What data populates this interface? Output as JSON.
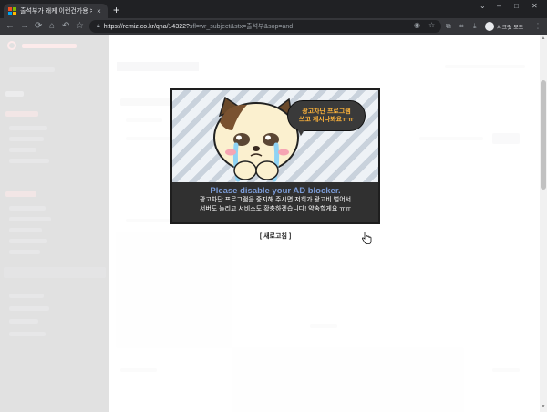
{
  "browser": {
    "tab_title": "출석부가 왜케 이런건가용 > 질문",
    "tab_close": "×",
    "new_tab": "+",
    "window_minimize": "–",
    "window_maximize": "□",
    "window_close": "✕",
    "tab_dropdown": "⌄",
    "url_host": "https://remiz.co.kr/qna/14322?",
    "url_rest": "sfl=wr_subject&stx=출석부&sop=and",
    "profile_label": "시크릿 모드",
    "nav": {
      "back": "←",
      "forward": "→",
      "reload": "⟳",
      "home": "⌂",
      "bookmark": "☆"
    }
  },
  "modal": {
    "speech_line1": "광고차단 프로그램",
    "speech_line2": "쓰고 계시나봐요ㅠㅠ",
    "headline": "Please disable your AD blocker.",
    "body_line1": "광고차단 프로그램을 중지해 주시면 저희가 광고비 벌어서",
    "body_line2": "서버도 늘리고 서비스도 확충하겠습니다! 약속할게요 ㅠㅠ",
    "refresh_label": "[ 새로고침 ]"
  },
  "colors": {
    "headline": "#7b9bd6",
    "speech_text": "#ffb43a",
    "page_overlay": "#ffffff"
  }
}
